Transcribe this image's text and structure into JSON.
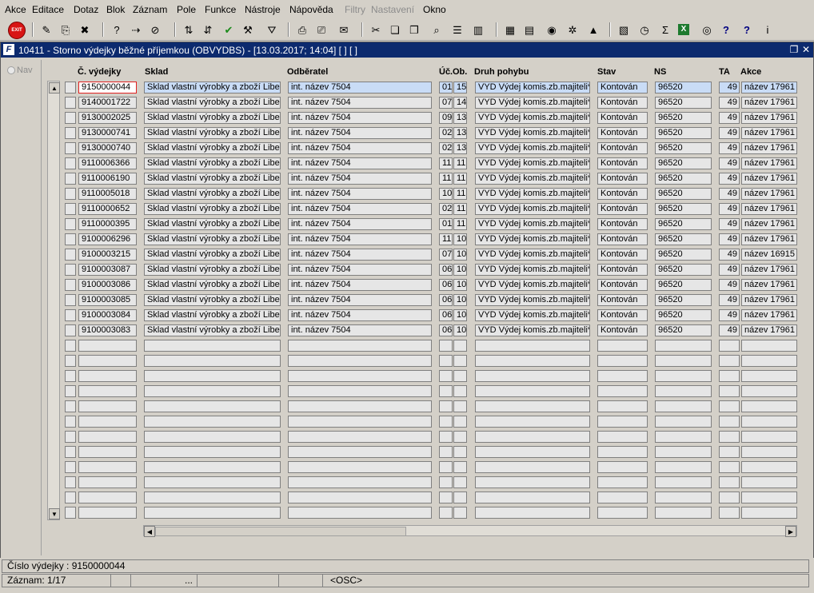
{
  "menu": [
    {
      "label": "Akce",
      "disabled": false
    },
    {
      "label": "Editace",
      "disabled": false
    },
    {
      "label": "Dotaz",
      "disabled": false
    },
    {
      "label": "Blok",
      "disabled": false
    },
    {
      "label": "Záznam",
      "disabled": false
    },
    {
      "label": "Pole",
      "disabled": false
    },
    {
      "label": "Funkce",
      "disabled": false
    },
    {
      "label": "Nástroje",
      "disabled": false
    },
    {
      "label": "Nápověda",
      "disabled": false
    },
    {
      "label": "Filtry",
      "disabled": true
    },
    {
      "label": "Nastavení",
      "disabled": true
    },
    {
      "label": "Okno",
      "disabled": false
    }
  ],
  "toolbar": {
    "exit_label": "EXIT",
    "icons": [
      "save-icon",
      "print-preview-icon",
      "delete-icon",
      "query-enter-icon",
      "query-execute-icon",
      "query-cancel-icon",
      "sort-asc-icon",
      "sort-desc-icon",
      "commit-check-icon",
      "wrench-icon",
      "filter-icon",
      "print-icon",
      "print-setup-icon",
      "mail-icon",
      "cut-icon",
      "copy-icon",
      "paste-icon",
      "find-icon",
      "list-icon",
      "columns-icon",
      "calculator-icon",
      "document-icon",
      "globe-icon",
      "settings-icon",
      "mountain-icon",
      "chart-icon",
      "clock-icon",
      "sum-icon",
      "excel-icon",
      "world-icon",
      "help-icon",
      "whatsthis-icon",
      "info-icon"
    ],
    "sum_glyph": "Σ"
  },
  "window": {
    "title": "10411 - Storno výdejky běžné příjemkou (OBVYDBS) - [13.03.2017; 14:04]  [ ]  [ ]",
    "nav_label": "Nav"
  },
  "columns": {
    "c_vydejky": "Č. výdejky",
    "sklad": "Sklad",
    "odberatel": "Odběratel",
    "uc": "Úč.",
    "ob": "Ob.",
    "druh": "Druh pohybu",
    "stav": "Stav",
    "ns": "NS",
    "ta": "TA",
    "akce": "Akce"
  },
  "rows": [
    {
      "c": "9150000044",
      "sklad": "Sklad vlastní výrobky a zboží Liber",
      "odb": "int. název 7504",
      "uc": "01",
      "ob": "15",
      "druh": "VYD Výdej komis.zb.majiteli*",
      "stav": "Kontován",
      "ns": "96520",
      "ta": "49",
      "akce": "název 17961"
    },
    {
      "c": "9140001722",
      "sklad": "Sklad vlastní výrobky a zboží Liber",
      "odb": "int. název 7504",
      "uc": "07",
      "ob": "14",
      "druh": "VYD Výdej komis.zb.majiteli*",
      "stav": "Kontován",
      "ns": "96520",
      "ta": "49",
      "akce": "název 17961"
    },
    {
      "c": "9130002025",
      "sklad": "Sklad vlastní výrobky a zboží Liber",
      "odb": "int. název 7504",
      "uc": "09",
      "ob": "13",
      "druh": "VYD Výdej komis.zb.majiteli*",
      "stav": "Kontován",
      "ns": "96520",
      "ta": "49",
      "akce": "název 17961"
    },
    {
      "c": "9130000741",
      "sklad": "Sklad vlastní výrobky a zboží Liber",
      "odb": "int. název 7504",
      "uc": "02",
      "ob": "13",
      "druh": "VYD Výdej komis.zb.majiteli*",
      "stav": "Kontován",
      "ns": "96520",
      "ta": "49",
      "akce": "název 17961"
    },
    {
      "c": "9130000740",
      "sklad": "Sklad vlastní výrobky a zboží Liber",
      "odb": "int. název 7504",
      "uc": "02",
      "ob": "13",
      "druh": "VYD Výdej komis.zb.majiteli*",
      "stav": "Kontován",
      "ns": "96520",
      "ta": "49",
      "akce": "název 17961"
    },
    {
      "c": "9110006366",
      "sklad": "Sklad vlastní výrobky a zboží Liber",
      "odb": "int. název 7504",
      "uc": "11",
      "ob": "11",
      "druh": "VYD Výdej komis.zb.majiteli*",
      "stav": "Kontován",
      "ns": "96520",
      "ta": "49",
      "akce": "název 17961"
    },
    {
      "c": "9110006190",
      "sklad": "Sklad vlastní výrobky a zboží Liber",
      "odb": "int. název 7504",
      "uc": "11",
      "ob": "11",
      "druh": "VYD Výdej komis.zb.majiteli*",
      "stav": "Kontován",
      "ns": "96520",
      "ta": "49",
      "akce": "název 17961"
    },
    {
      "c": "9110005018",
      "sklad": "Sklad vlastní výrobky a zboží Liber",
      "odb": "int. název 7504",
      "uc": "10",
      "ob": "11",
      "druh": "VYD Výdej komis.zb.majiteli*",
      "stav": "Kontován",
      "ns": "96520",
      "ta": "49",
      "akce": "název 17961"
    },
    {
      "c": "9110000652",
      "sklad": "Sklad vlastní výrobky a zboží Liber",
      "odb": "int. název 7504",
      "uc": "02",
      "ob": "11",
      "druh": "VYD Výdej komis.zb.majiteli*",
      "stav": "Kontován",
      "ns": "96520",
      "ta": "49",
      "akce": "název 17961"
    },
    {
      "c": "9110000395",
      "sklad": "Sklad vlastní výrobky a zboží Liber",
      "odb": "int. název 7504",
      "uc": "01",
      "ob": "11",
      "druh": "VYD Výdej komis.zb.majiteli*",
      "stav": "Kontován",
      "ns": "96520",
      "ta": "49",
      "akce": "název 17961"
    },
    {
      "c": "9100006296",
      "sklad": "Sklad vlastní výrobky a zboží Liber",
      "odb": "int. název 7504",
      "uc": "11",
      "ob": "10",
      "druh": "VYD Výdej komis.zb.majiteli*",
      "stav": "Kontován",
      "ns": "96520",
      "ta": "49",
      "akce": "název 17961"
    },
    {
      "c": "9100003215",
      "sklad": "Sklad vlastní výrobky a zboží Liber",
      "odb": "int. název 7504",
      "uc": "07",
      "ob": "10",
      "druh": "VYD Výdej komis.zb.majiteli*",
      "stav": "Kontován",
      "ns": "96520",
      "ta": "49",
      "akce": "název 16915"
    },
    {
      "c": "9100003087",
      "sklad": "Sklad vlastní výrobky a zboží Liber",
      "odb": "int. název 7504",
      "uc": "06",
      "ob": "10",
      "druh": "VYD Výdej komis.zb.majiteli*",
      "stav": "Kontován",
      "ns": "96520",
      "ta": "49",
      "akce": "název 17961"
    },
    {
      "c": "9100003086",
      "sklad": "Sklad vlastní výrobky a zboží Liber",
      "odb": "int. název 7504",
      "uc": "06",
      "ob": "10",
      "druh": "VYD Výdej komis.zb.majiteli*",
      "stav": "Kontován",
      "ns": "96520",
      "ta": "49",
      "akce": "název 17961"
    },
    {
      "c": "9100003085",
      "sklad": "Sklad vlastní výrobky a zboží Liber",
      "odb": "int. název 7504",
      "uc": "06",
      "ob": "10",
      "druh": "VYD Výdej komis.zb.majiteli*",
      "stav": "Kontován",
      "ns": "96520",
      "ta": "49",
      "akce": "název 17961"
    },
    {
      "c": "9100003084",
      "sklad": "Sklad vlastní výrobky a zboží Liber",
      "odb": "int. název 7504",
      "uc": "06",
      "ob": "10",
      "druh": "VYD Výdej komis.zb.majiteli*",
      "stav": "Kontován",
      "ns": "96520",
      "ta": "49",
      "akce": "název 17961"
    },
    {
      "c": "9100003083",
      "sklad": "Sklad vlastní výrobky a zboží Liber",
      "odb": "int. název 7504",
      "uc": "06",
      "ob": "10",
      "druh": "VYD Výdej komis.zb.majiteli*",
      "stav": "Kontován",
      "ns": "96520",
      "ta": "49",
      "akce": "název 17961"
    }
  ],
  "empty_rows": 12,
  "status": {
    "field_info": "Číslo výdejky : 9150000044",
    "record": "Záznam: 1/17",
    "ellipsis": "...",
    "osc": "<OSC>"
  },
  "colors": {
    "titlebar": "#0c2a6e",
    "selected": "#c9dcf6",
    "focus_border": "#e02020"
  }
}
